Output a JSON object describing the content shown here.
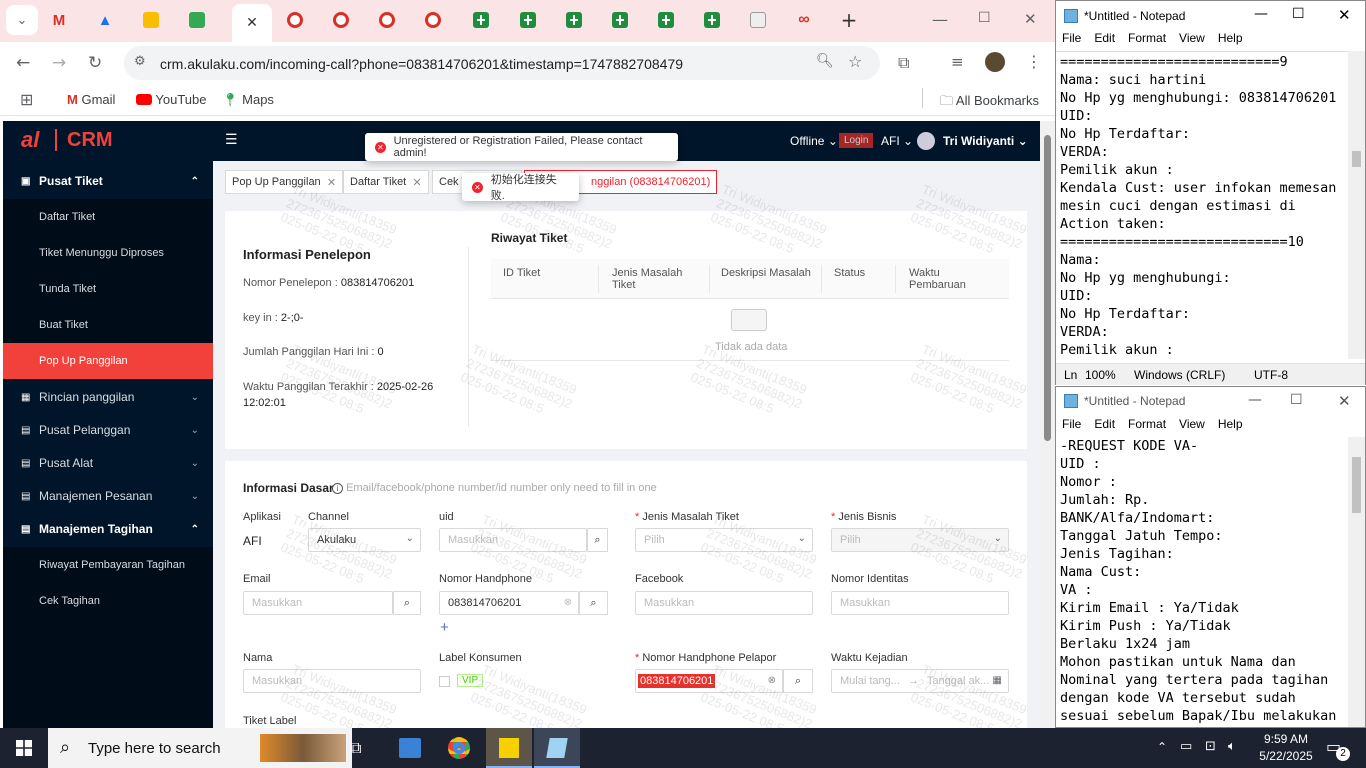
{
  "browser": {
    "url": "crm.akulaku.com/incoming-call?phone=083814706201&timestamp=1747882708479",
    "bookmarks": [
      "Gmail",
      "YouTube",
      "Maps"
    ],
    "all_bookmarks": "All Bookmarks"
  },
  "crm": {
    "logo_text": "CRM",
    "logo_small": "al",
    "header": {
      "status": "Offline",
      "login": "Login",
      "app": "AFI",
      "user": "Tri Widiyanti"
    },
    "toast_error": "Unregistered or Registration Failed, Please contact admin!",
    "toast_conn": "初始化连接失败.",
    "menu": {
      "pusat_tiket": "Pusat Tiket",
      "daftar_tiket": "Daftar Tiket",
      "tiket_menunggu": "Tiket Menunggu Diproses",
      "tunda_tiket": "Tunda Tiket",
      "buat_tiket": "Buat Tiket",
      "popup_panggilan": "Pop Up Panggilan",
      "rincian": "Rincian panggilan",
      "pusat_pelanggan": "Pusat Pelanggan",
      "pusat_alat": "Pusat Alat",
      "manajemen_pesanan": "Manajemen Pesanan",
      "manajemen_tagihan": "Manajemen Tagihan",
      "riwayat_pembayaran": "Riwayat Pembayaran Tagihan",
      "cek_tagihan": "Cek Tagihan"
    },
    "tabs": [
      "Pop Up Panggilan",
      "Daftar Tiket",
      "Cek T",
      "nggilan (083814706201)"
    ],
    "info_penelepon": {
      "title": "Informasi Penelepon",
      "nomor_label": "Nomor Penelepon :",
      "nomor": "083814706201",
      "keyin_label": "key in :",
      "keyin": "2-;0-",
      "jumlah_label": "Jumlah Panggilan Hari Ini :",
      "jumlah": "0",
      "waktu_label": "Waktu Panggilan Terakhir :",
      "waktu1": "2025-02-26",
      "waktu2": "12:02:01"
    },
    "riwayat": {
      "title": "Riwayat Tiket",
      "cols": [
        "ID Tiket",
        "Jenis Masalah Tiket",
        "Deskripsi Masalah",
        "Status",
        "Waktu Pembaruan"
      ],
      "empty": "Tidak ada data"
    },
    "info_dasar": {
      "title": "Informasi Dasar",
      "hint": "Email/facebook/phone number/id number only need to fill in one",
      "aplikasi": "Aplikasi",
      "aplikasi_val": "AFI",
      "channel": "Channel",
      "channel_val": "Akulaku",
      "uid": "uid",
      "jenis_masalah": "Jenis Masalah Tiket",
      "jenis_bisnis": "Jenis Bisnis",
      "email": "Email",
      "nomor_hp": "Nomor Handphone",
      "nomor_hp_val": "083814706201",
      "facebook": "Facebook",
      "nomor_identitas": "Nomor Identitas",
      "nama": "Nama",
      "label_konsumen": "Label Konsumen",
      "vip": "VIP",
      "nomor_pelapor": "Nomor Handphone Pelapor",
      "nomor_pelapor_val": "083814706201",
      "waktu_kejadian": "Waktu Kejadian",
      "mulai": "Mulai tang...",
      "tanggal_ak": "Tanggal ak...",
      "tiket_label": "Tiket Label",
      "placeholder": "Masukkan",
      "pilih": "Pilih"
    },
    "watermark": "Tri Widiyanti(18359\n27236752506882)2\n025-05-22 08:5"
  },
  "notepad1": {
    "title": "*Untitled - Notepad",
    "menu": [
      "File",
      "Edit",
      "Format",
      "View",
      "Help"
    ],
    "lines": [
      "===========================9",
      "Nama: suci hartini",
      "No Hp yg menghubungi: 083814706201",
      "UID:",
      "No Hp Terdaftar:",
      "VERDA:",
      "Pemilik akun :",
      "Kendala Cust: user infokan memesan",
      "mesin cuci dengan estimasi di",
      "Action taken:",
      "============================10",
      "Nama:",
      "No Hp yg menghubungi:",
      "UID:",
      "No Hp Terdaftar:",
      "VERDA:",
      "Pemilik akun :"
    ],
    "status": {
      "ln": "Ln",
      "zoom": "100%",
      "eol": "Windows (CRLF)",
      "enc": "UTF-8"
    }
  },
  "notepad2": {
    "title": "*Untitled - Notepad",
    "menu": [
      "File",
      "Edit",
      "Format",
      "View",
      "Help"
    ],
    "lines": [
      "-REQUEST KODE VA-",
      "UID :",
      "Nomor :",
      "Jumlah: Rp.",
      "BANK/Alfa/Indomart:",
      "Tanggal Jatuh Tempo:",
      "Jenis Tagihan:",
      "Nama Cust:",
      "VA :",
      "Kirim Email : Ya/Tidak",
      "Kirim Push : Ya/Tidak",
      "Berlaku 1x24 jam",
      "Mohon pastikan untuk Nama dan",
      "Nominal yang tertera pada tagihan",
      "dengan kode VA tersebut sudah",
      "sesuai sebelum Bapak/Ibu melakukan"
    ]
  },
  "taskbar": {
    "search": "Type here to search",
    "time": "9:59 AM",
    "date": "5/22/2025",
    "notif": "2"
  }
}
